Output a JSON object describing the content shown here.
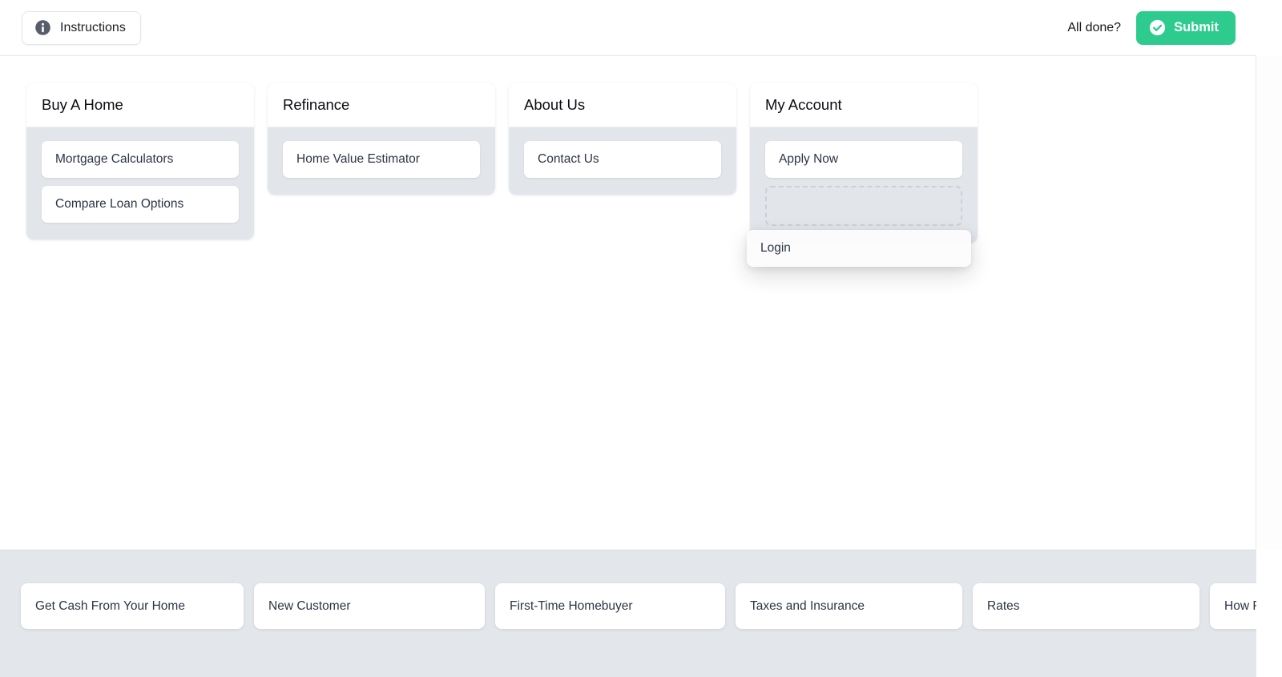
{
  "topbar": {
    "instructions_label": "Instructions",
    "instructions_icon": "info-icon",
    "all_done_label": "All done?",
    "submit_label": "Submit",
    "submit_icon": "check-circle-icon",
    "submit_color": "#2ecb8e"
  },
  "columns": [
    {
      "title": "Buy A Home",
      "items": [
        {
          "label": "Mortgage Calculators"
        },
        {
          "label": "Compare Loan Options"
        }
      ]
    },
    {
      "title": "Refinance",
      "items": [
        {
          "label": "Home Value Estimator"
        }
      ]
    },
    {
      "title": "About Us",
      "items": [
        {
          "label": "Contact Us"
        }
      ]
    },
    {
      "title": "My Account",
      "items": [
        {
          "label": "Apply Now"
        }
      ]
    }
  ],
  "drag": {
    "active": true,
    "label": "Login",
    "source_column": "My Account",
    "drop_placeholder_visible": true
  },
  "tray": {
    "items": [
      {
        "label": "Get Cash From Your Home"
      },
      {
        "label": "New Customer"
      },
      {
        "label": "First-Time Homebuyer"
      },
      {
        "label": "Taxes and Insurance"
      },
      {
        "label": "Rates"
      },
      {
        "label": "How Refinancing Works"
      }
    ]
  }
}
